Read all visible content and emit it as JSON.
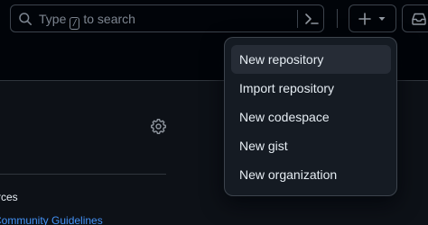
{
  "search": {
    "placeholder_before": "Type",
    "slash_key": "/",
    "placeholder_after": "to search"
  },
  "sidebar": {
    "resources_heading": "rces",
    "guidelines_link": "Community Guidelines"
  },
  "create_menu": {
    "items": [
      {
        "label": "New repository",
        "highlighted": true
      },
      {
        "label": "Import repository",
        "highlighted": false
      },
      {
        "label": "New codespace",
        "highlighted": false
      },
      {
        "label": "New gist",
        "highlighted": false
      },
      {
        "label": "New organization",
        "highlighted": false
      }
    ]
  },
  "icons": {
    "search": "search-icon",
    "command_palette": "command-palette-icon",
    "create": "plus-icon",
    "create_caret": "caret-down-icon",
    "inbox": "inbox-icon",
    "settings": "gear-icon"
  },
  "colors": {
    "page_background": "#010409",
    "content_background": "#0d1117",
    "menu_background": "#151b23",
    "menu_highlight": "#262c36",
    "border": "#3d444d",
    "text_primary": "#e6edf3",
    "text_muted": "#7d8590",
    "link": "#4493f8"
  }
}
